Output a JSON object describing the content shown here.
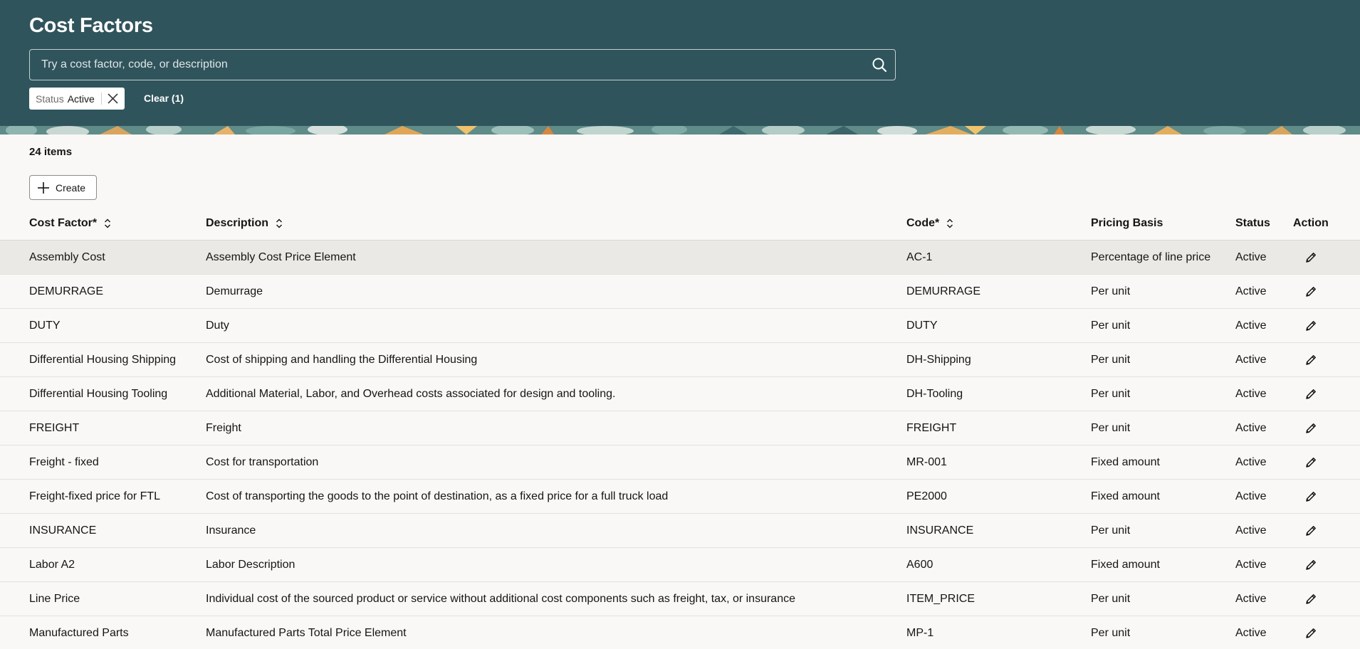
{
  "header": {
    "title": "Cost Factors",
    "search_placeholder": "Try a cost factor, code, or description",
    "filter_chip": {
      "key": "Status",
      "value": "Active"
    },
    "clear_label": "Clear (1)"
  },
  "toolbar": {
    "item_count": "24 items",
    "create_label": "Create"
  },
  "table": {
    "columns": [
      "Cost Factor*",
      "Description",
      "Code*",
      "Pricing Basis",
      "Status",
      "Action"
    ],
    "rows": [
      [
        "Assembly Cost",
        "Assembly Cost Price Element",
        "AC-1",
        "Percentage of line price",
        "Active"
      ],
      [
        "DEMURRAGE",
        "Demurrage",
        "DEMURRAGE",
        "Per unit",
        "Active"
      ],
      [
        "DUTY",
        "Duty",
        "DUTY",
        "Per unit",
        "Active"
      ],
      [
        "Differential Housing Shipping",
        "Cost of shipping and handling the Differential Housing",
        "DH-Shipping",
        "Per unit",
        "Active"
      ],
      [
        "Differential Housing Tooling",
        "Additional Material, Labor, and Overhead costs associated for design and tooling.",
        "DH-Tooling",
        "Per unit",
        "Active"
      ],
      [
        "FREIGHT",
        "Freight",
        "FREIGHT",
        "Per unit",
        "Active"
      ],
      [
        "Freight - fixed",
        "Cost for transportation",
        "MR-001",
        "Fixed amount",
        "Active"
      ],
      [
        "Freight-fixed price for FTL",
        "Cost of transporting the goods to the point of destination, as a fixed price for a full truck load",
        "PE2000",
        "Fixed amount",
        "Active"
      ],
      [
        "INSURANCE",
        "Insurance",
        "INSURANCE",
        "Per unit",
        "Active"
      ],
      [
        "Labor A2",
        "Labor Description",
        "A600",
        "Fixed amount",
        "Active"
      ],
      [
        "Line Price",
        "Individual cost of the sourced product or service without additional cost components such as freight, tax, or insurance",
        "ITEM_PRICE",
        "Per unit",
        "Active"
      ],
      [
        "Manufactured Parts",
        "Manufactured Parts Total Price Element",
        "MP-1",
        "Per unit",
        "Active"
      ]
    ]
  },
  "icons": {
    "search": "search-icon",
    "close": "close-icon",
    "plus": "plus-icon",
    "sort": "sort-icon",
    "edit": "pencil-icon"
  },
  "colors": {
    "header_bg": "#30545c",
    "page_bg": "#f9f8f6",
    "selected_row_bg": "#ebe9e6"
  }
}
